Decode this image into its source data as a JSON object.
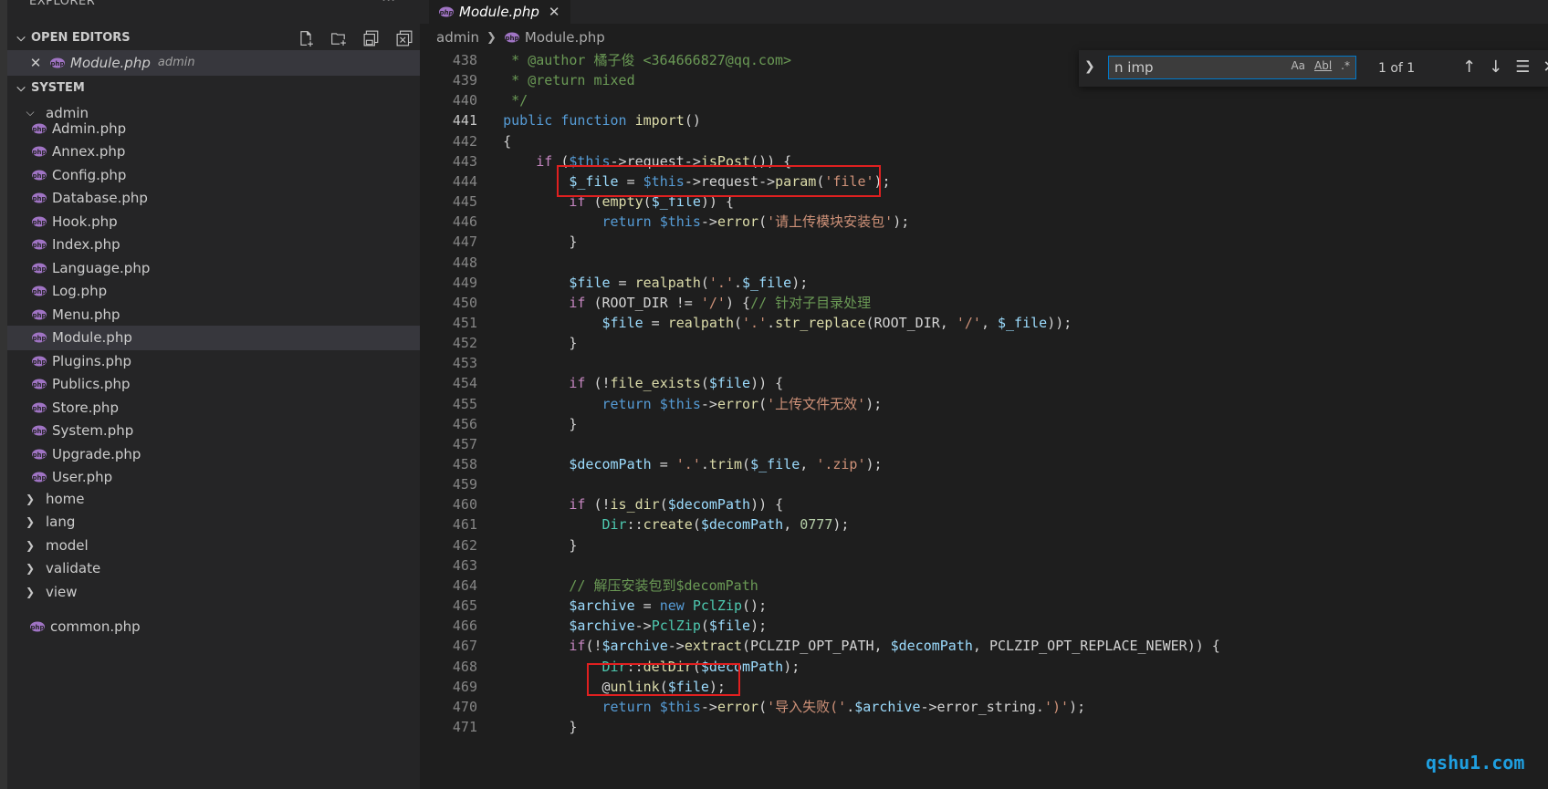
{
  "sidebar": {
    "title": "EXPLORER",
    "more": "···",
    "open_editors": {
      "label": "OPEN EDITORS",
      "items": [
        {
          "close": "✕",
          "name": "Module.php",
          "description": "admin"
        }
      ]
    },
    "workspace": {
      "label": "SYSTEM",
      "folder": "admin",
      "files": [
        "Admin.php",
        "Annex.php",
        "Config.php",
        "Database.php",
        "Hook.php",
        "Index.php",
        "Language.php",
        "Log.php",
        "Menu.php",
        "Module.php",
        "Plugins.php",
        "Publics.php",
        "Store.php",
        "System.php",
        "Upgrade.php",
        "User.php"
      ],
      "selected": "Module.php",
      "folders": [
        "home",
        "lang",
        "model",
        "validate",
        "view"
      ],
      "root_file": "common.php"
    }
  },
  "editor": {
    "tab": {
      "label": "Module.php",
      "close": "✕"
    },
    "breadcrumb": {
      "folder": "admin",
      "file": "Module.php"
    },
    "find": {
      "query": "n imp",
      "options": [
        "Aa",
        "Abl",
        ".*"
      ],
      "count": "1 of 1"
    },
    "lines": [
      {
        "n": "438",
        "text": "     * @author 橘子俊 <364666827@qq.com>"
      },
      {
        "n": "439",
        "text": "     * @return mixed"
      },
      {
        "n": "440",
        "text": "     */"
      },
      {
        "n": "441",
        "text": "    public function import()"
      },
      {
        "n": "442",
        "text": "    {"
      },
      {
        "n": "443",
        "text": "        if ($this->request->isPost()) {"
      },
      {
        "n": "444",
        "text": "            $_file = $this->request->param('file');"
      },
      {
        "n": "445",
        "text": "            if (empty($_file)) {"
      },
      {
        "n": "446",
        "text": "                return $this->error('请上传模块安装包');"
      },
      {
        "n": "447",
        "text": "            }"
      },
      {
        "n": "448",
        "text": ""
      },
      {
        "n": "449",
        "text": "            $file = realpath('.'.$_file);"
      },
      {
        "n": "450",
        "text": "            if (ROOT_DIR != '/') {// 针对子目录处理"
      },
      {
        "n": "451",
        "text": "                $file = realpath('.'.str_replace(ROOT_DIR, '/', $_file));"
      },
      {
        "n": "452",
        "text": "            }"
      },
      {
        "n": "453",
        "text": ""
      },
      {
        "n": "454",
        "text": "            if (!file_exists($file)) {"
      },
      {
        "n": "455",
        "text": "                return $this->error('上传文件无效');"
      },
      {
        "n": "456",
        "text": "            }"
      },
      {
        "n": "457",
        "text": ""
      },
      {
        "n": "458",
        "text": "            $decomPath = '.'.trim($_file, '.zip');"
      },
      {
        "n": "459",
        "text": ""
      },
      {
        "n": "460",
        "text": "            if (!is_dir($decomPath)) {"
      },
      {
        "n": "461",
        "text": "                Dir::create($decomPath, 0777);"
      },
      {
        "n": "462",
        "text": "            }"
      },
      {
        "n": "463",
        "text": ""
      },
      {
        "n": "464",
        "text": "            // 解压安装包到$decomPath"
      },
      {
        "n": "465",
        "text": "            $archive = new PclZip();"
      },
      {
        "n": "466",
        "text": "            $archive->PclZip($file);"
      },
      {
        "n": "467",
        "text": "            if(!$archive->extract(PCLZIP_OPT_PATH, $decomPath, PCLZIP_OPT_REPLACE_NEWER)) {"
      },
      {
        "n": "468",
        "text": "                Dir::delDir($decomPath);"
      },
      {
        "n": "469",
        "text": "                @unlink($file);"
      },
      {
        "n": "470",
        "text": "                return $this->error('导入失败('.$archive->error_string.')');"
      },
      {
        "n": "471",
        "text": "            }"
      }
    ],
    "active_line": "441"
  },
  "watermark": "qshu1.com",
  "colors": {
    "accent": "#007acc",
    "annotation_box": "#e02020",
    "watermark": "#1f9fe0"
  }
}
